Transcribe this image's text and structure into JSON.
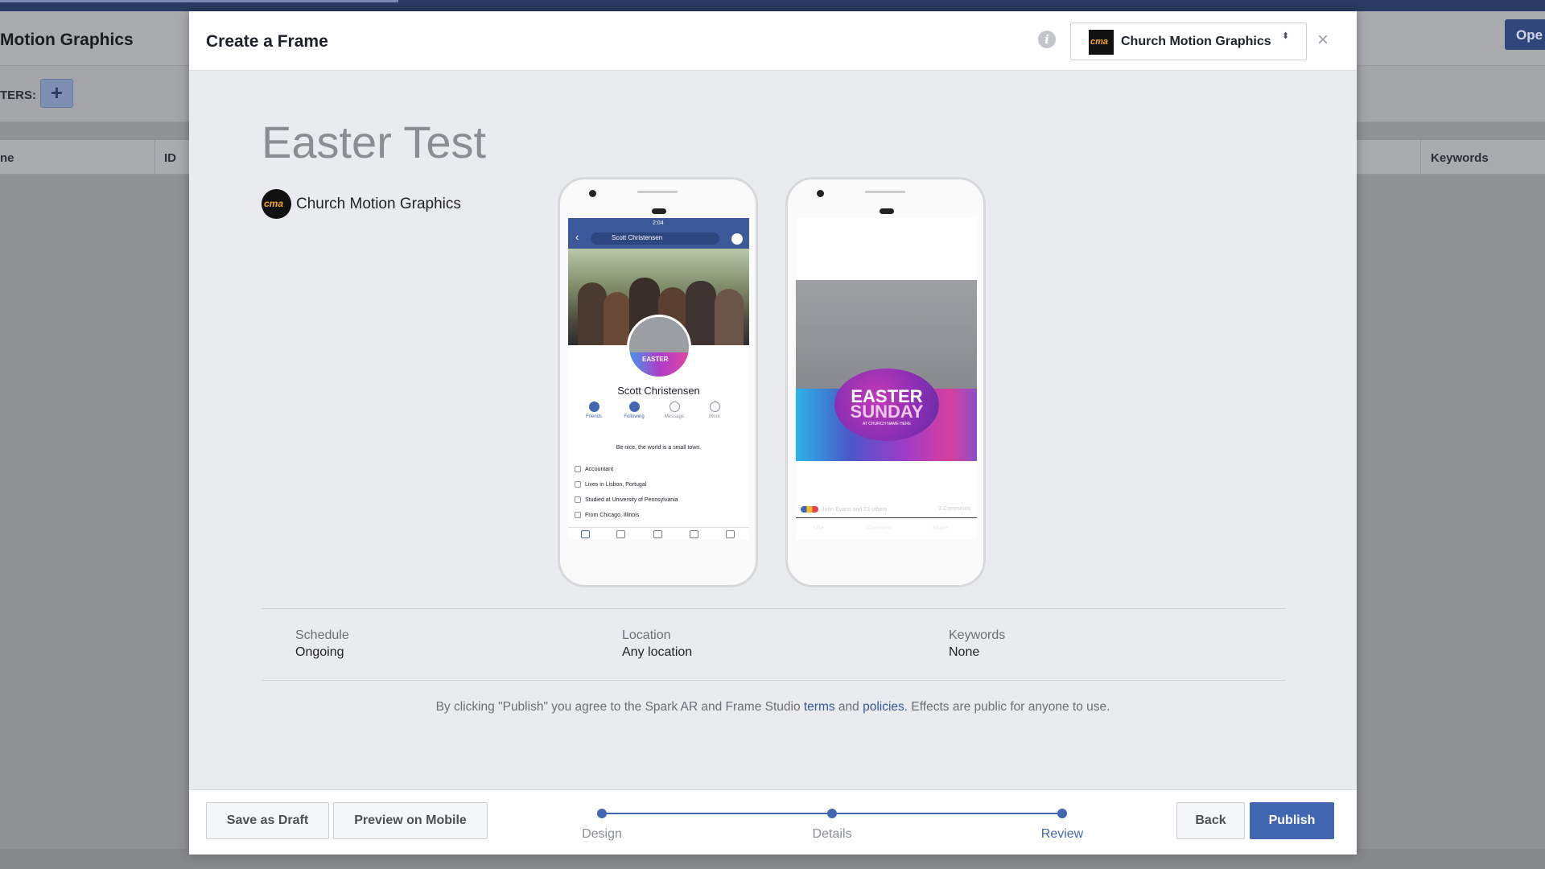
{
  "background": {
    "title": "Motion Graphics",
    "open_button": "Ope",
    "filters_label": "TERS:",
    "add_symbol": "+",
    "table_headers": [
      "ne",
      "ID",
      "Keywords"
    ]
  },
  "modal": {
    "title": "Create a Frame",
    "page_selector": {
      "logo_text": "cma",
      "name": "Church Motion Graphics",
      "caret": "⬍"
    },
    "close_symbol": "×",
    "info_symbol": "i"
  },
  "frame": {
    "title": "Easter Test",
    "owner": {
      "logo_text": "cma",
      "name": "Church Motion Graphics"
    }
  },
  "profile_preview": {
    "time": "2:04",
    "search_text": "Scott Christensen",
    "avatar_text": "EASTER",
    "name": "Scott Christensen",
    "actions": [
      "Friends",
      "Following",
      "Message",
      "More"
    ],
    "bio": "Be nice, the world is a small town.",
    "info": [
      "Accountant",
      "Lives in Lisbon, Portugal",
      "Studied at University of Pennsylvania",
      "From Chicago, Illinois"
    ]
  },
  "post_preview": {
    "badge_line1": "EASTER",
    "badge_line2": "SUNDAY",
    "badge_line3": "AT CHURCH NAME HERE",
    "reactions": "John Evans and 23 others",
    "comments": "2 Comments",
    "actions": [
      "Like",
      "Comment",
      "Share"
    ]
  },
  "details": [
    {
      "label": "Schedule",
      "value": "Ongoing"
    },
    {
      "label": "Location",
      "value": "Any location"
    },
    {
      "label": "Keywords",
      "value": "None"
    }
  ],
  "terms": {
    "prefix": "By clicking \"Publish\" you agree to the Spark AR and Frame Studio ",
    "terms_link": "terms",
    "middle": " and ",
    "policies_link": "policies.",
    "suffix": " Effects are public for anyone to use."
  },
  "footer": {
    "save_draft": "Save as Draft",
    "preview_mobile": "Preview on Mobile",
    "steps": [
      "Design",
      "Details",
      "Review"
    ],
    "active_step": "Review",
    "back": "Back",
    "publish": "Publish"
  },
  "colors": {
    "accent": "#4267b2",
    "modal_bg": "#eaebef",
    "overlay": "#8f9194"
  }
}
